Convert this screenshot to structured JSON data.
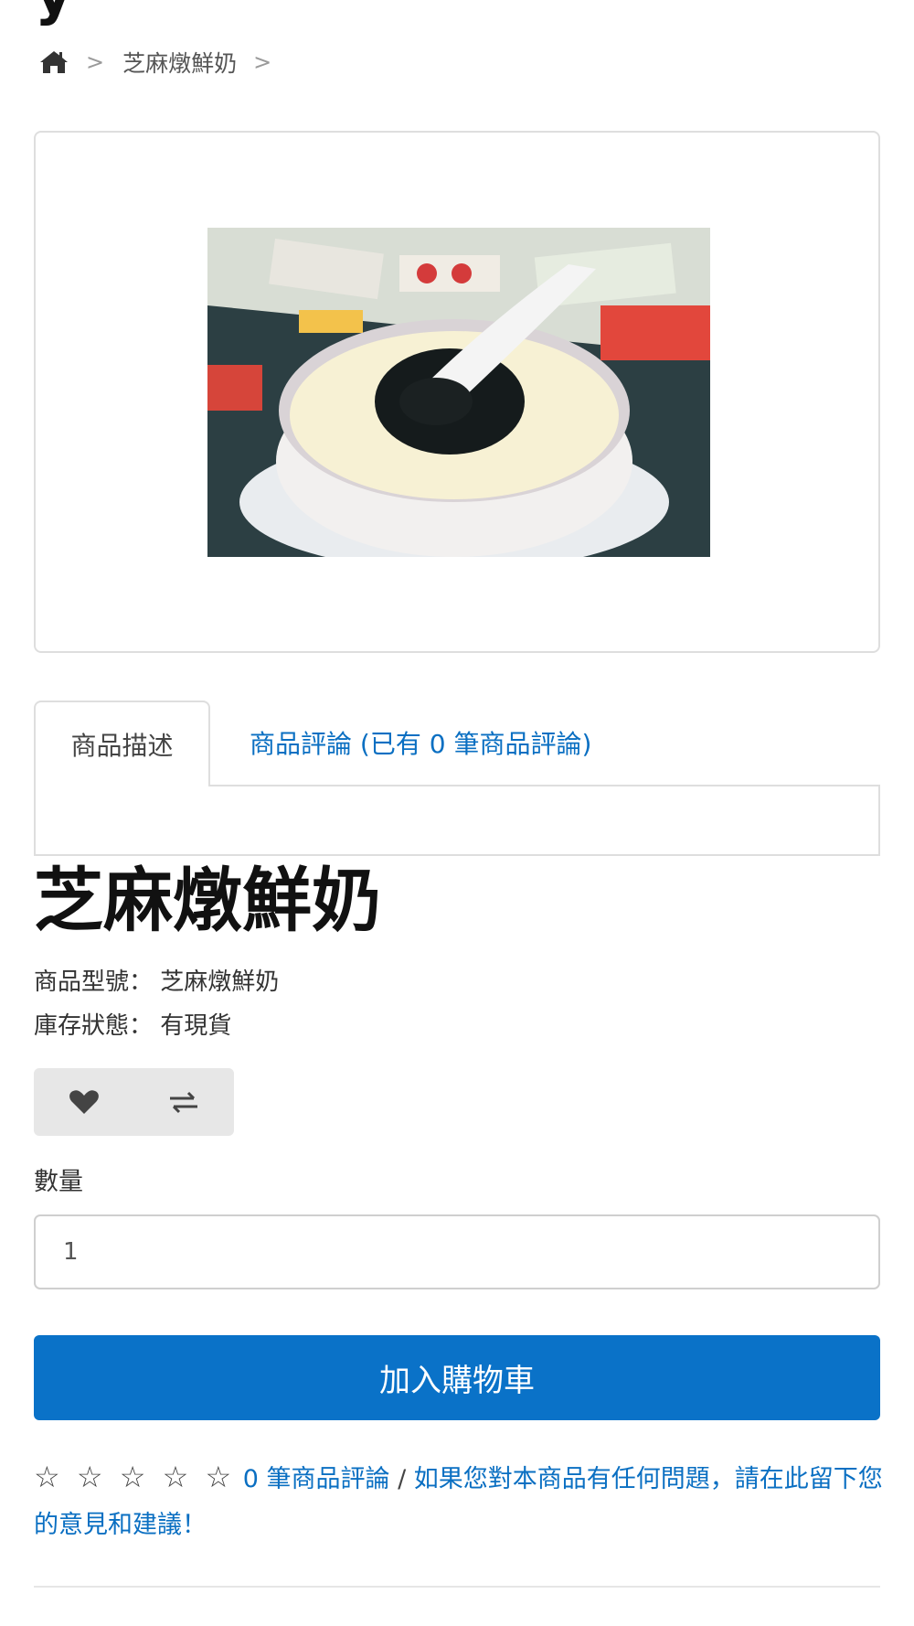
{
  "header": {
    "title_fragment": "y"
  },
  "breadcrumb": {
    "home_icon": "home-icon",
    "separator": ">",
    "current": "芝麻燉鮮奶",
    "trailing_separator": ">"
  },
  "product_image": {
    "alt": "芝麻燉鮮奶"
  },
  "tabs": {
    "description_label": "商品描述",
    "reviews_label": "商品評論 (已有 0 筆商品評論)"
  },
  "product": {
    "name": "芝麻燉鮮奶",
    "model_label": "商品型號：",
    "model_value": "芝麻燉鮮奶",
    "stock_label": "庫存狀態：",
    "stock_value": "有現貨"
  },
  "actions": {
    "wishlist_icon": "heart-icon",
    "compare_icon": "exchange-arrows-icon"
  },
  "quantity": {
    "label": "數量",
    "value": "1"
  },
  "cart": {
    "button_label": "加入購物車"
  },
  "reviews": {
    "stars": "☆ ☆ ☆ ☆ ☆",
    "rating": 0,
    "count_link": "0 筆商品評論",
    "separator": "/",
    "write_link": "如果您對本商品有任何問題，請在此留下您的意見和建議！"
  },
  "colors": {
    "accent": "#0a72c8",
    "link": "#0a6fc2",
    "border": "#dedede"
  }
}
